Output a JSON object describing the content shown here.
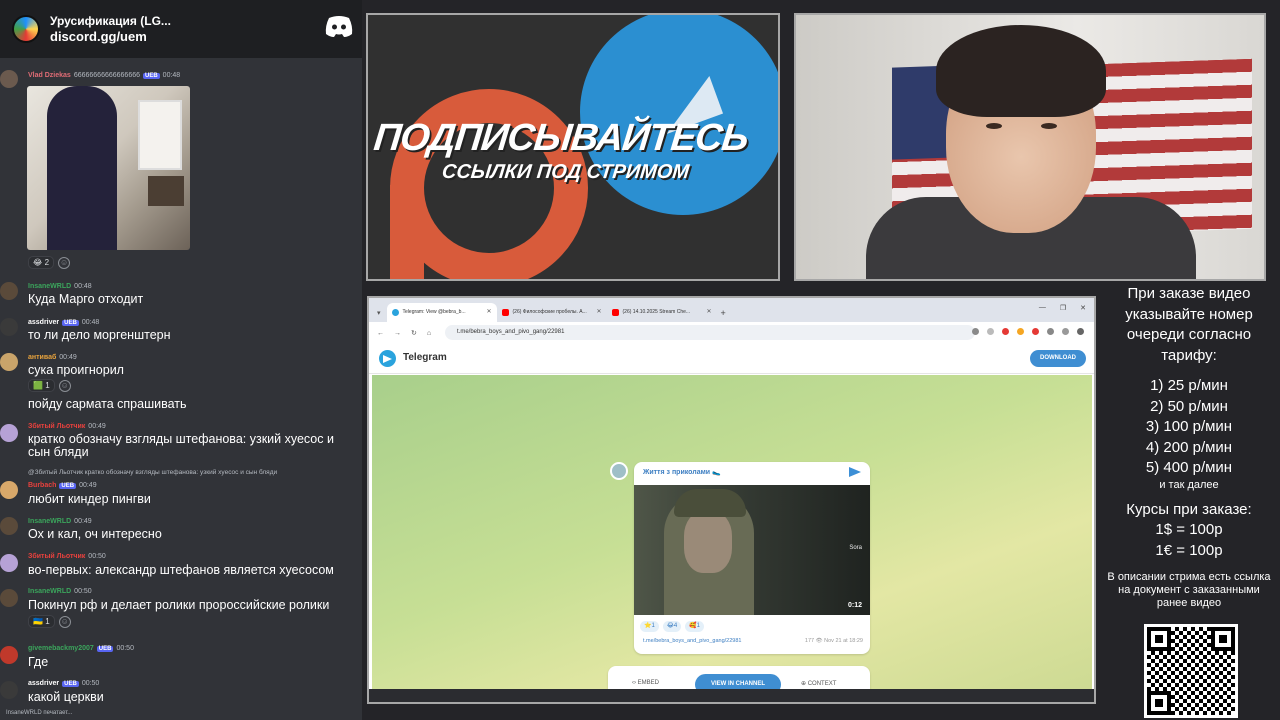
{
  "discord": {
    "server_name": "Урусификация (LG...",
    "server_link": "discord.gg/uem",
    "messages": [
      {
        "user": "Vlad Dziekas",
        "user_color": "#e06c75",
        "suffix": "66666666666666666",
        "badge": "UEB",
        "time": "00:48",
        "text": "",
        "reactions": [
          {
            "emoji": "😂",
            "count": "2"
          }
        ]
      },
      {
        "user": "InsaneWRLD",
        "user_color": "#3ba55c",
        "badge": "",
        "time": "00:48",
        "text": "Куда Марго отходит"
      },
      {
        "user": "assdriver",
        "user_color": "#ffffff",
        "badge": "UEB",
        "time": "00:48",
        "text": "то ли дело моргенштерн"
      },
      {
        "user": "антиваб",
        "user_color": "#e8a33d",
        "badge": "",
        "time": "00:49",
        "text": "сука проигнорил",
        "reactions": [
          {
            "emoji": "🟩",
            "count": "1"
          }
        ]
      },
      {
        "user": "",
        "text": "пойду сармата спрашивать"
      },
      {
        "user": "Збитый Льотчик",
        "user_color": "#e8413d",
        "badge": "",
        "time": "00:49",
        "text": "кратко обозначу взгляды штефанова: узкий хуесос и сын бляди"
      },
      {
        "reply": "@Збитый Льотчик кратко обозначу взгляды штефанова: узкий хуесос и сын бляди",
        "user": "Burbach",
        "user_color": "#e8413d",
        "badge": "UEB",
        "time": "00:49",
        "text": "любит киндер пингви"
      },
      {
        "user": "InsaneWRLD",
        "user_color": "#3ba55c",
        "badge": "",
        "time": "00:49",
        "text": "Ох и кал, оч интересно"
      },
      {
        "user": "Збитый Льотчик",
        "user_color": "#e8413d",
        "badge": "",
        "time": "00:50",
        "text": "во-первых: александр штефанов является хуесосом"
      },
      {
        "user": "InsaneWRLD",
        "user_color": "#3ba55c",
        "badge": "",
        "time": "00:50",
        "text": "Покинул рф и делает ролики пророссийские ролики",
        "reactions": [
          {
            "emoji": "🇺🇦",
            "count": "1"
          }
        ]
      },
      {
        "user": "givemebackmy2007",
        "user_color": "#3ba55c",
        "badge": "UEB",
        "time": "00:50",
        "text": "Где"
      },
      {
        "user": "assdriver",
        "user_color": "#ffffff",
        "badge": "UEB",
        "time": "00:50",
        "text": "какой церкви"
      }
    ],
    "typing": "InsaneWRLD печатает..."
  },
  "banner": {
    "title": "ПОДПИСЫВАЙТЕСЬ",
    "subtitle": "ССЫЛКИ ПОД СТРИМОМ"
  },
  "browser": {
    "tabs": [
      {
        "label": "Telegram: View @bebra_b...",
        "color": "#2aa3dd",
        "active": true
      },
      {
        "label": "(26) Философские пробелы. А...",
        "color": "#ff0000",
        "active": false
      },
      {
        "label": "(26) 14.10.2025 Stream Che...",
        "color": "#ff0000",
        "active": false
      }
    ],
    "url": "t.me/bebra_boys_and_pivo_gang/22981",
    "telegram": {
      "app_name": "Telegram",
      "download_label": "DOWNLOAD",
      "channel_name": "Життя з приколами 🥿",
      "video_watermark": "Sora",
      "video_duration": "0:12",
      "reactions": [
        {
          "emoji": "⭐",
          "count": "1"
        },
        {
          "emoji": "😂",
          "count": "4"
        },
        {
          "emoji": "🥰",
          "count": "1"
        }
      ],
      "post_link": "t.me/bebra_boys_and_pivo_gang/22981",
      "views": "177",
      "date": "Nov 21 at 18:29",
      "embed_label": "EMBED",
      "view_channel_label": "VIEW IN CHANNEL",
      "context_label": "CONTEXT"
    }
  },
  "info": {
    "intro": "При заказе видео указывайте номер очереди согласно тарифу:",
    "tariffs": [
      "1) 25 р/мин",
      "2) 50 р/мин",
      "3) 100 р/мин",
      "4) 200 р/мин",
      "5) 400 р/мин"
    ],
    "tariff_more": "и так далее",
    "rates_title": "Курсы при заказе:",
    "rates": [
      "1$ = 100р",
      "1€ = 100р"
    ],
    "footer": "В описании стрима есть ссылка на документ с заказанными ранее видео"
  }
}
